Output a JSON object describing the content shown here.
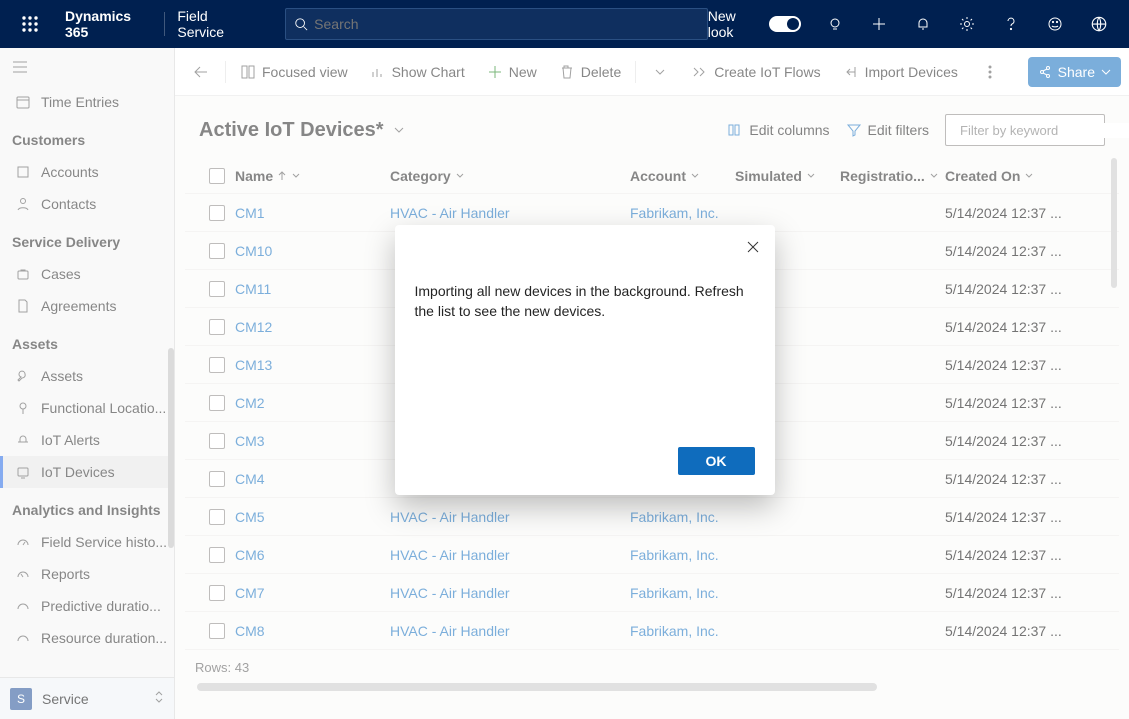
{
  "topbar": {
    "brand": "Dynamics 365",
    "app_name": "Field Service",
    "search_placeholder": "Search",
    "new_look_label": "New look"
  },
  "sidebar": {
    "time_entries": "Time Entries",
    "group_customers": "Customers",
    "accounts": "Accounts",
    "contacts": "Contacts",
    "group_service_delivery": "Service Delivery",
    "cases": "Cases",
    "agreements": "Agreements",
    "group_assets": "Assets",
    "assets": "Assets",
    "functional_loc": "Functional Locatio...",
    "iot_alerts": "IoT Alerts",
    "iot_devices": "IoT Devices",
    "group_analytics": "Analytics and Insights",
    "fs_historical": "Field Service histo...",
    "reports": "Reports",
    "predictive": "Predictive duratio...",
    "resource_dur": "Resource duration...",
    "area_badge": "S",
    "area_name": "Service"
  },
  "commands": {
    "focused_view": "Focused view",
    "show_chart": "Show Chart",
    "new": "New",
    "delete": "Delete",
    "create_iot_flows": "Create IoT Flows",
    "import_devices": "Import Devices",
    "share": "Share"
  },
  "view": {
    "title": "Active IoT Devices*",
    "edit_columns": "Edit columns",
    "edit_filters": "Edit filters",
    "filter_placeholder": "Filter by keyword"
  },
  "columns": {
    "name": "Name",
    "category": "Category",
    "account": "Account",
    "simulated": "Simulated",
    "registration": "Registratio...",
    "created_on": "Created On"
  },
  "rows": [
    {
      "name": "CM1",
      "category": "HVAC - Air Handler",
      "account": "Fabrikam, Inc.",
      "created": "5/14/2024 12:37 ..."
    },
    {
      "name": "CM10",
      "category": "",
      "account": "",
      "created": "5/14/2024 12:37 ..."
    },
    {
      "name": "CM11",
      "category": "",
      "account": "",
      "created": "5/14/2024 12:37 ..."
    },
    {
      "name": "CM12",
      "category": "",
      "account": "",
      "created": "5/14/2024 12:37 ..."
    },
    {
      "name": "CM13",
      "category": "",
      "account": "",
      "created": "5/14/2024 12:37 ..."
    },
    {
      "name": "CM2",
      "category": "",
      "account": "",
      "created": "5/14/2024 12:37 ..."
    },
    {
      "name": "CM3",
      "category": "",
      "account": "",
      "created": "5/14/2024 12:37 ..."
    },
    {
      "name": "CM4",
      "category": "",
      "account": "",
      "created": "5/14/2024 12:37 ..."
    },
    {
      "name": "CM5",
      "category": "HVAC - Air Handler",
      "account": "Fabrikam, Inc.",
      "created": "5/14/2024 12:37 ..."
    },
    {
      "name": "CM6",
      "category": "HVAC - Air Handler",
      "account": "Fabrikam, Inc.",
      "created": "5/14/2024 12:37 ..."
    },
    {
      "name": "CM7",
      "category": "HVAC - Air Handler",
      "account": "Fabrikam, Inc.",
      "created": "5/14/2024 12:37 ..."
    },
    {
      "name": "CM8",
      "category": "HVAC - Air Handler",
      "account": "Fabrikam, Inc.",
      "created": "5/14/2024 12:37 ..."
    }
  ],
  "footer": {
    "rows_label": "Rows: 43"
  },
  "dialog": {
    "message": "Importing all new devices in the background. Refresh the list to see the new devices.",
    "ok": "OK"
  }
}
